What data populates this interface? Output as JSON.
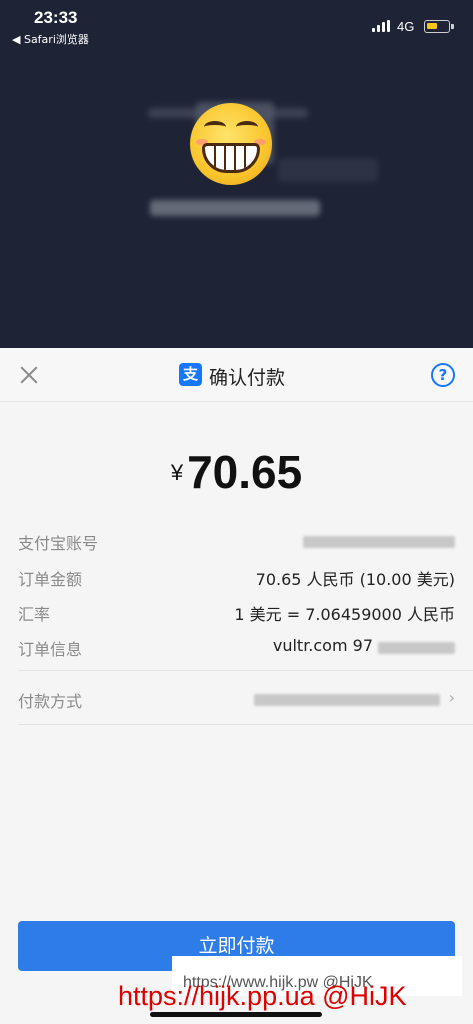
{
  "status_bar": {
    "time": "23:33",
    "back_app": "◀ Safari浏览器",
    "network": "4G",
    "battery_color": "#f5c518"
  },
  "sheet": {
    "title": "确认付款",
    "payment_brand_icon": "支",
    "help_symbol": "?"
  },
  "amount": {
    "currency": "¥",
    "value": "70.65"
  },
  "details": {
    "account_label": "支付宝账号",
    "order_amount_label": "订单金额",
    "order_amount_value": "70.65 人民币 (10.00 美元)",
    "rate_label": "汇率",
    "rate_value": "1 美元 = 7.06459000 人民币",
    "order_info_label": "订单信息",
    "order_info_value": "vultr.com 97",
    "payment_method_label": "付款方式",
    "payment_method_chevron": "›"
  },
  "pay_button": {
    "label": "立即付款",
    "color": "#2e7ce8"
  },
  "watermarks": {
    "line1": "https://www.hijk.pw @HiJK",
    "line2": "https://hijk.pp.ua @HiJK"
  },
  "colors": {
    "header_bg": "#1e2436",
    "accent": "#1677ff"
  }
}
